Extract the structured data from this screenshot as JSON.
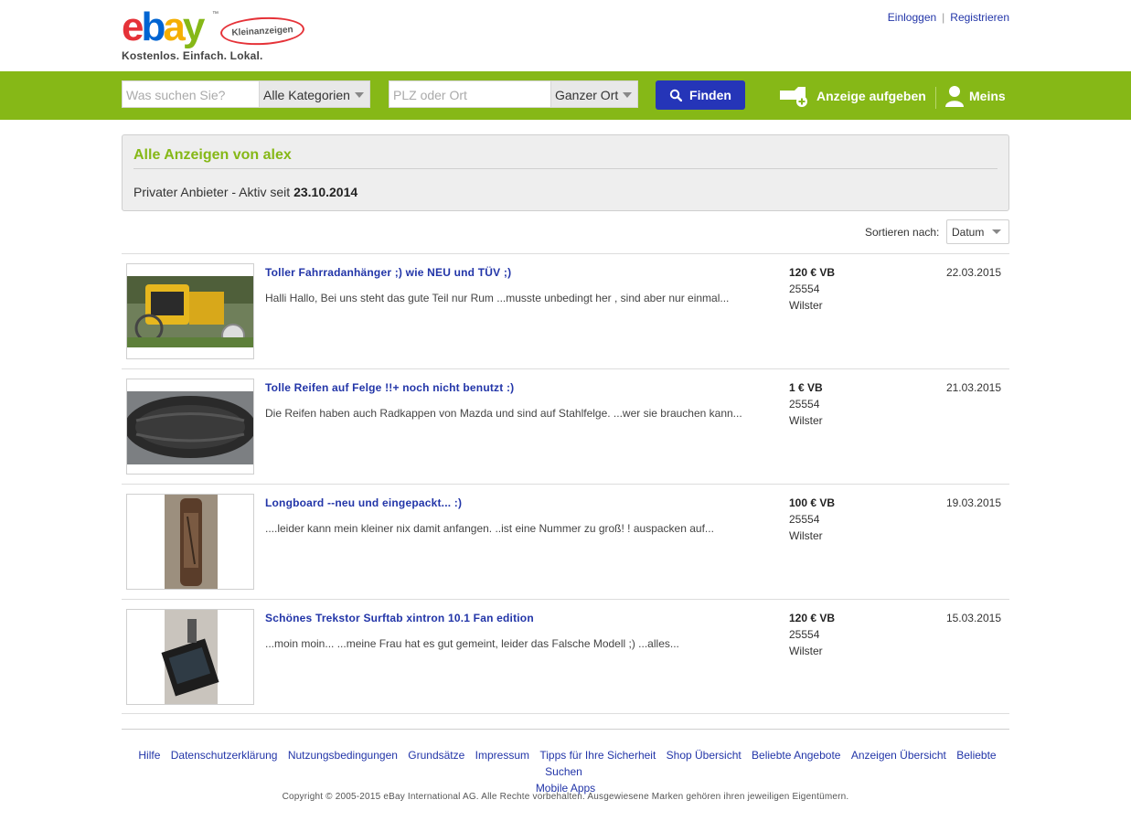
{
  "header": {
    "logo_brand": "ebay",
    "logo_sub": "Kleinanzeigen",
    "tagline": "Kostenlos. Einfach. Lokal.",
    "login": "Einloggen",
    "register": "Registrieren"
  },
  "search": {
    "query_placeholder": "Was suchen Sie?",
    "category": "Alle Kategorien",
    "location_placeholder": "PLZ oder Ort",
    "radius": "Ganzer Ort",
    "find_label": "Finden",
    "post_ad": "Anzeige aufgeben",
    "account": "Meins"
  },
  "seller": {
    "title": "Alle Anzeigen von alex",
    "info_prefix": "Privater Anbieter - Aktiv seit",
    "active_since": "23.10.2014"
  },
  "sort": {
    "label": "Sortieren nach:",
    "value": "Datum"
  },
  "ads": [
    {
      "title": "Toller Fahrradanhänger ;) wie NEU und TÜV ;)",
      "desc": "Halli Hallo, Bei uns steht das gute Teil nur Rum ...musste unbedingt her , sind aber nur einmal...",
      "price": "120 € VB",
      "zip": "25554",
      "city": "Wilster",
      "date": "22.03.2015"
    },
    {
      "title": "Tolle Reifen auf Felge !!+ noch nicht benutzt :)",
      "desc": "Die Reifen haben auch Radkappen von Mazda und sind auf Stahlfelge. ...wer sie brauchen kann...",
      "price": "1 € VB",
      "zip": "25554",
      "city": "Wilster",
      "date": "21.03.2015"
    },
    {
      "title": "Longboard --neu und eingepackt... :)",
      "desc": "....leider kann mein kleiner nix damit anfangen. ..ist eine Nummer zu groß! ! auspacken auf...",
      "price": "100 € VB",
      "zip": "25554",
      "city": "Wilster",
      "date": "19.03.2015"
    },
    {
      "title": "Schönes Trekstor Surftab xintron 10.1 Fan edition",
      "desc": "...moin moin... ...meine Frau hat es gut gemeint, leider das Falsche Modell ;) ...alles...",
      "price": "120 € VB",
      "zip": "25554",
      "city": "Wilster",
      "date": "15.03.2015"
    }
  ],
  "footer": {
    "links": [
      "Hilfe",
      "Datenschutzerklärung",
      "Nutzungsbedingungen",
      "Grundsätze",
      "Impressum",
      "Tipps für Ihre Sicherheit",
      "Shop Übersicht",
      "Beliebte Angebote",
      "Anzeigen Übersicht",
      "Beliebte Suchen",
      "Mobile Apps"
    ],
    "copyright": "Copyright © 2005-2015 eBay International AG. Alle Rechte vorbehalten. Ausgewiesene Marken gehören ihren jeweiligen Eigentümern."
  },
  "colors": {
    "brand_green": "#86b817",
    "link_blue": "#2235a8",
    "button_blue": "#2535b8"
  },
  "icons": [
    "search-icon",
    "post-ad-icon",
    "user-icon",
    "dropdown-arrow-icon"
  ]
}
